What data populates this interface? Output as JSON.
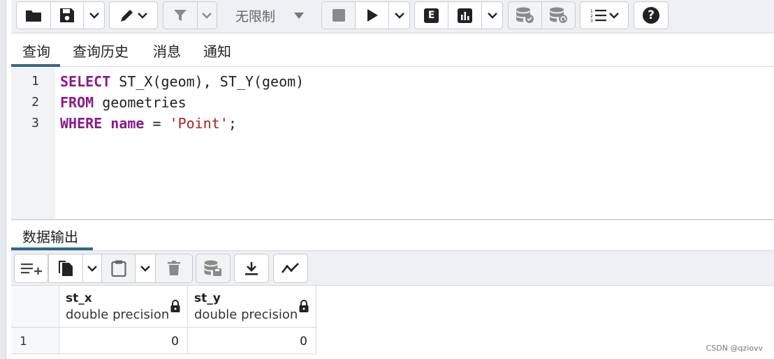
{
  "toolbar": {
    "open_file": "folder-icon",
    "save": "floppy-icon",
    "edit": "pencil-icon",
    "filter": "filter-icon",
    "limit_value": "无限制",
    "stop": "stop-icon",
    "execute": "play-icon",
    "explain": "E",
    "explain_analyze": "chart-icon",
    "commit": "db-check-icon",
    "rollback": "db-undo-icon",
    "macros": "list-icon",
    "help": "?"
  },
  "tabs": [
    "查询",
    "查询历史",
    "消息",
    "通知"
  ],
  "editor": {
    "line_numbers": [
      "1",
      "2",
      "3"
    ],
    "lines": [
      [
        {
          "t": "SELECT",
          "k": "kw"
        },
        {
          "t": " ST_X(geom), ST_Y(geom)",
          "k": ""
        }
      ],
      [
        {
          "t": "FROM",
          "k": "kw"
        },
        {
          "t": " geometries",
          "k": ""
        }
      ],
      [
        {
          "t": "WHERE",
          "k": "kw"
        },
        {
          "t": " ",
          "k": ""
        },
        {
          "t": "name",
          "k": "kw"
        },
        {
          "t": " = ",
          "k": ""
        },
        {
          "t": "'Point'",
          "k": "str"
        },
        {
          "t": ";",
          "k": ""
        }
      ]
    ],
    "colors": {
      "keyword": "#8a1a8a",
      "string": "#b02020"
    }
  },
  "output": {
    "tab_label": "数据输出",
    "columns": [
      {
        "name": "st_x",
        "type": "double precision"
      },
      {
        "name": "st_y",
        "type": "double precision"
      }
    ],
    "rows": [
      {
        "index": "1",
        "values": [
          "0",
          "0"
        ]
      }
    ]
  },
  "watermark": "CSDN @qziovv",
  "accent_color": "#326690"
}
